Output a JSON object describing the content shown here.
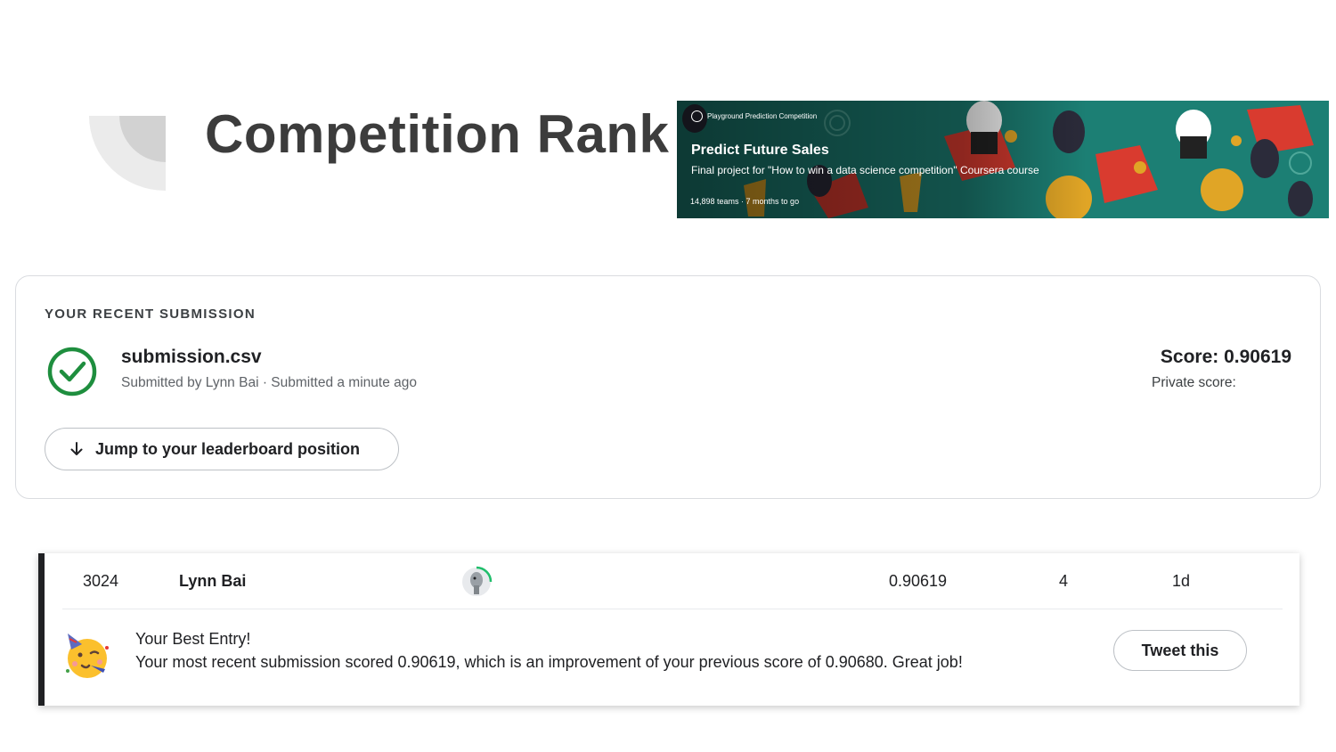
{
  "slide": {
    "title": "Competition Rank"
  },
  "banner": {
    "competition_type": "Playground Prediction Competition",
    "title": "Predict Future Sales",
    "subtitle": "Final project for \"How to win a data science competition\" Coursera course",
    "meta": "14,898 teams · 7 months to go",
    "background_color": "#1c7f74"
  },
  "submission": {
    "heading": "YOUR RECENT SUBMISSION",
    "file_name": "submission.csv",
    "submitted_by": "Submitted by Lynn Bai · Submitted a minute ago",
    "score": "Score: 0.90619",
    "private_score": "Private score:",
    "jump_button": "Jump to your leaderboard position",
    "status_icon": "check-circle-icon",
    "status_color": "#1e8e3e"
  },
  "leaderboard": {
    "rank": "3024",
    "team": "Lynn Bai",
    "avatar_icon": "ostrich-avatar-icon",
    "score": "0.90619",
    "entries": "4",
    "last": "1d",
    "best_entry_title": "Your Best Entry!",
    "best_entry_message": "Your most recent submission scored 0.90619, which is an improvement of your previous score of 0.90680. Great job!",
    "tweet_button": "Tweet this",
    "emoji_icon": "partying-face-icon"
  }
}
